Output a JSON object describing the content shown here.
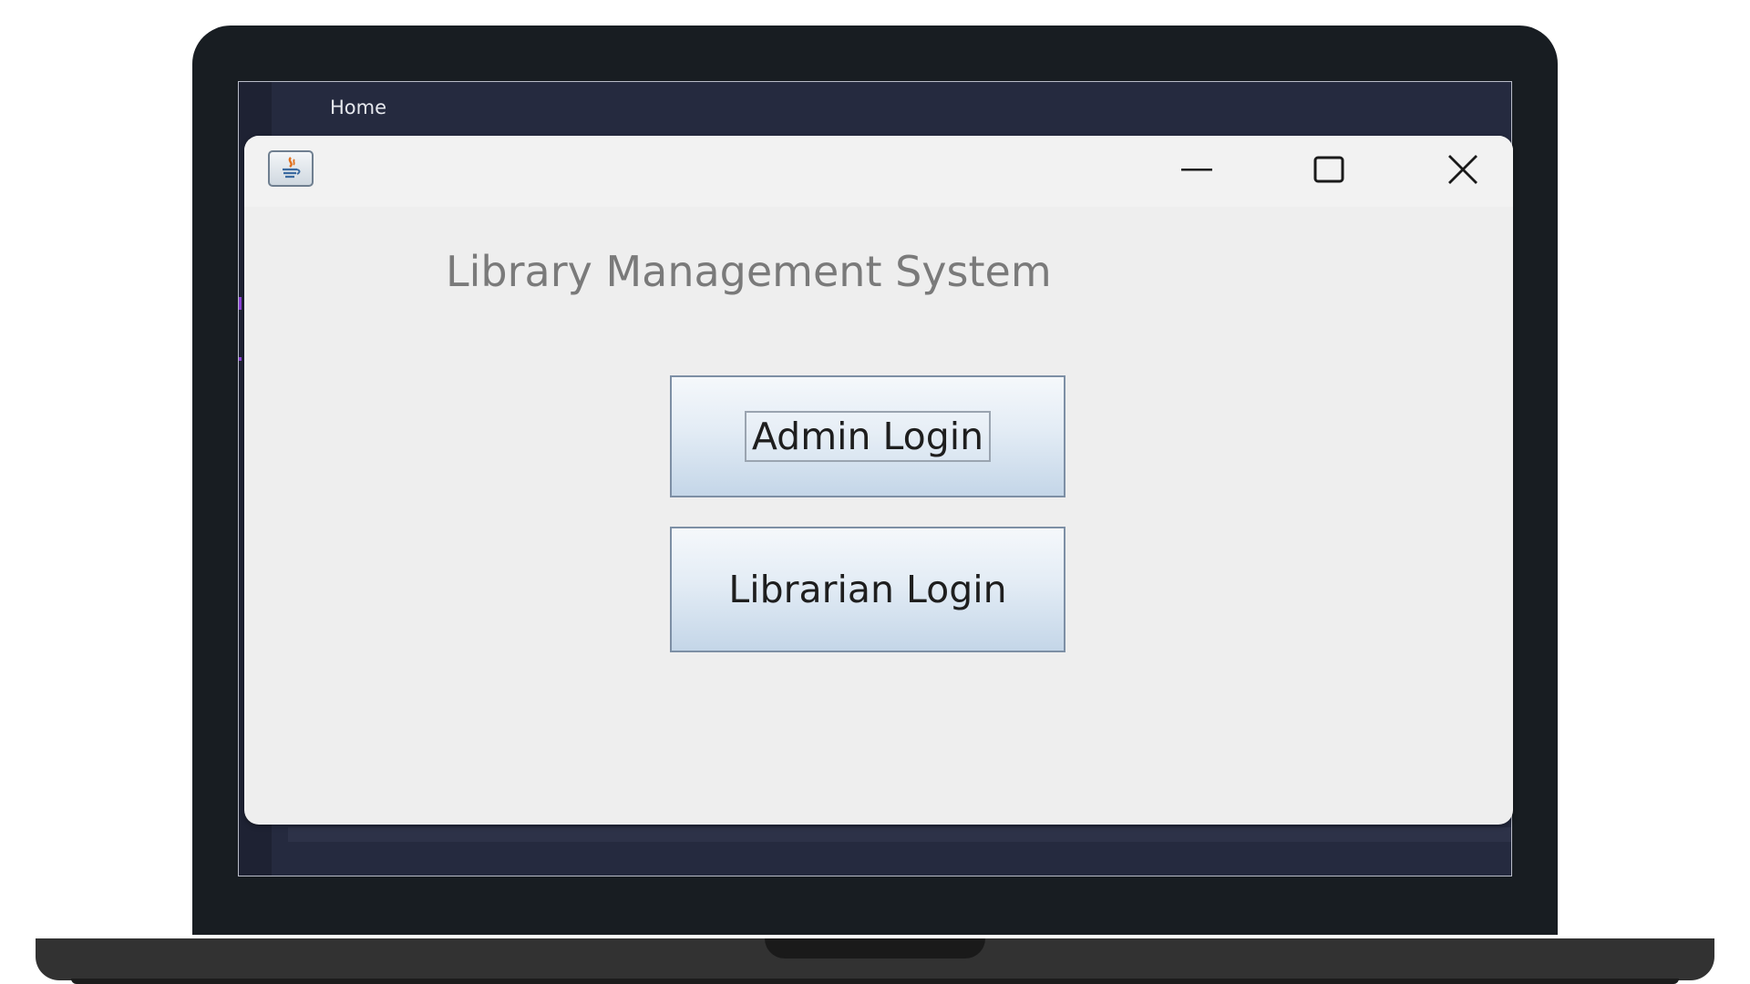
{
  "ide": {
    "tab_label": "Home"
  },
  "window": {
    "icon": "java-coffee-icon",
    "controls": {
      "minimize_icon": "minimize-icon",
      "maximize_icon": "maximize-icon",
      "close_icon": "close-icon"
    }
  },
  "main": {
    "title": "Library Management System",
    "buttons": [
      {
        "label": "Admin Login"
      },
      {
        "label": "Librarian Login"
      }
    ]
  },
  "colors": {
    "window_bg": "#eeeeee",
    "title_text": "#7a7a7a",
    "button_border": "#7d8fa5",
    "ide_bg": "#252a3f",
    "bezel": "#181d22"
  }
}
